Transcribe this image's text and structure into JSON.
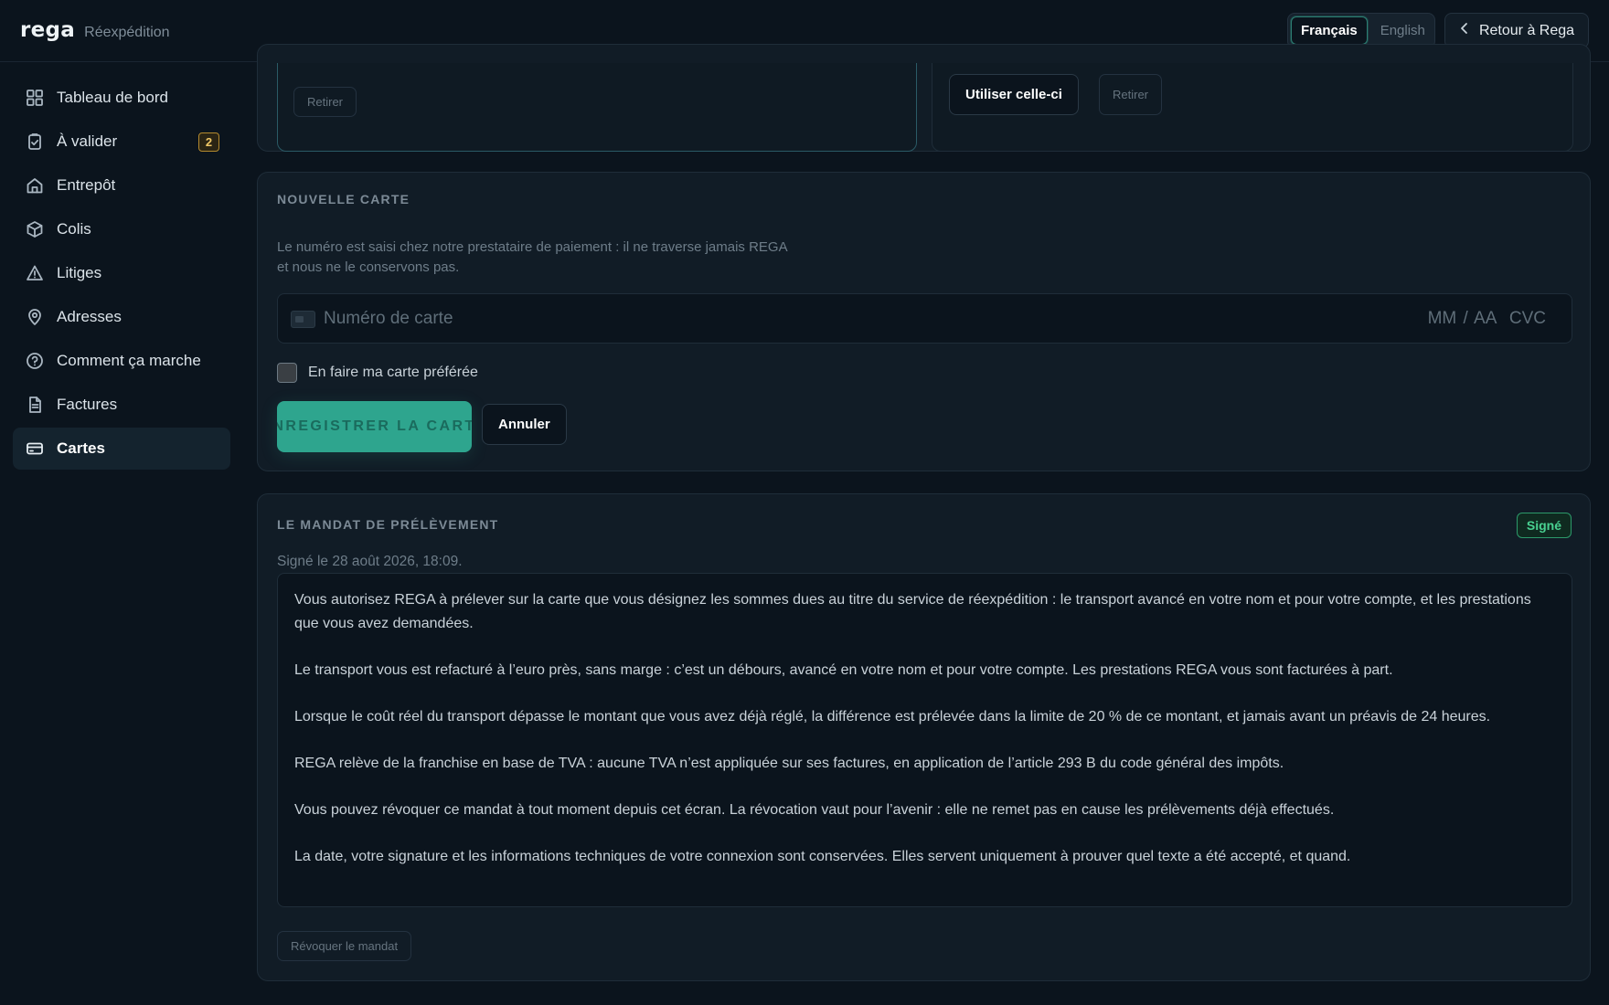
{
  "brand": {
    "logo": "rega",
    "subtitle": "Réexpédition"
  },
  "header": {
    "languages": [
      {
        "label": "Français",
        "active": true
      },
      {
        "label": "English",
        "active": false
      }
    ],
    "back_label": "Retour à Rega"
  },
  "sidebar": {
    "items": [
      {
        "label": "Tableau de bord",
        "icon": "dashboard-icon"
      },
      {
        "label": "À valider",
        "icon": "check-clipboard-icon",
        "badge": "2"
      },
      {
        "label": "Entrepôt",
        "icon": "warehouse-icon"
      },
      {
        "label": "Colis",
        "icon": "package-icon"
      },
      {
        "label": "Litiges",
        "icon": "warning-icon"
      },
      {
        "label": "Adresses",
        "icon": "map-pin-icon"
      },
      {
        "label": "Comment ça marche",
        "icon": "help-circle-icon"
      },
      {
        "label": "Factures",
        "icon": "invoice-icon"
      },
      {
        "label": "Cartes",
        "icon": "credit-card-icon",
        "active": true
      }
    ]
  },
  "saved_cards": {
    "remove_label_a": "Retirer",
    "use_label": "Utiliser celle-ci",
    "remove_label_b": "Retirer"
  },
  "new_card": {
    "title": "Nouvelle carte",
    "description_line1": "Le numéro est saisi chez notre prestataire de paiement : il ne traverse jamais REGA",
    "description_line2": "et nous ne le conservons pas.",
    "card_number_placeholder": "Numéro de carte",
    "expiry_cvc_placeholder": "MM / AA  CVC",
    "default_checkbox_label": "En faire ma carte préférée",
    "save_label": "Enregistrer la carte",
    "cancel_label": "Annuler"
  },
  "mandate": {
    "title": "Le mandat de prélèvement",
    "status": "Signé",
    "signed_on": "Signé le 28 août 2026, 18:09.",
    "paragraphs": [
      "Vous autorisez REGA à prélever sur la carte que vous désignez les sommes dues au titre du service de réexpédition : le transport avancé en votre nom et pour votre compte, et les prestations que vous avez demandées.",
      "Le transport vous est refacturé à l’euro près, sans marge : c’est un débours, avancé en votre nom et pour votre compte. Les prestations REGA vous sont facturées à part.",
      "Lorsque le coût réel du transport dépasse le montant que vous avez déjà réglé, la différence est prélevée dans la limite de 20 % de ce montant, et jamais avant un préavis de 24 heures.",
      "REGA relève de la franchise en base de TVA : aucune TVA n’est appliquée sur ses factures, en application de l’article 293 B du code général des impôts.",
      "Vous pouvez révoquer ce mandat à tout moment depuis cet écran. La révocation vaut pour l’avenir : elle ne remet pas en cause les prélèvements déjà effectués.",
      "La date, votre signature et les informations techniques de votre connexion sont conservées. Elles servent uniquement à prouver quel texte a été accepté, et quand."
    ],
    "revoke_label": "Révoquer le mandat"
  },
  "colors": {
    "background": "#0b141d",
    "card": "#111c26",
    "accent": "#2ea58e",
    "badge": "#f0c866",
    "success": "#49d191"
  }
}
